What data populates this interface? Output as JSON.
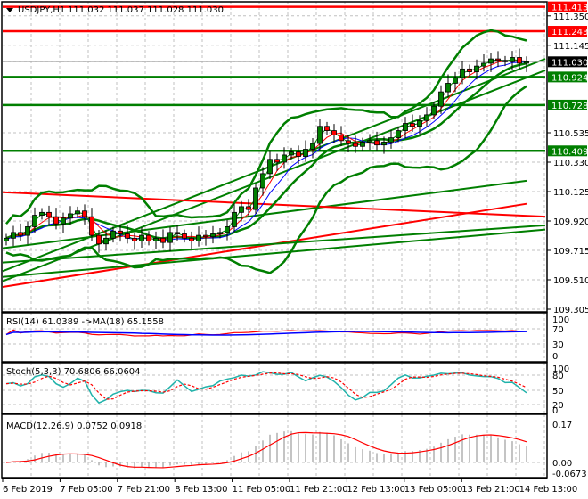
{
  "header": {
    "symbol": "USDJPY,H1",
    "ohlc": "111.032 111.037 111.028 111.030"
  },
  "chart_data": {
    "type": "candlestick",
    "symbol": "USDJPY",
    "timeframe": "H1",
    "price_axis": {
      "range": [
        109.305,
        111.413
      ],
      "ticks": [
        "111.350",
        "111.145",
        "110.535",
        "110.330",
        "110.125",
        "109.920",
        "109.715",
        "109.510",
        "109.305"
      ]
    },
    "time_labels": [
      "6 Feb 2019",
      "7 Feb 05:00",
      "7 Feb 21:00",
      "8 Feb 13:00",
      "11 Feb 05:00",
      "11 Feb 21:00",
      "12 Feb 13:00",
      "13 Feb 05:00",
      "13 Feb 21:00",
      "14 Feb 13:00"
    ],
    "closes": [
      109.8,
      109.84,
      109.82,
      109.88,
      109.96,
      109.98,
      109.95,
      109.9,
      109.94,
      109.97,
      109.99,
      109.95,
      109.82,
      109.76,
      109.8,
      109.85,
      109.83,
      109.8,
      109.78,
      109.82,
      109.78,
      109.8,
      109.77,
      109.84,
      109.83,
      109.8,
      109.78,
      109.82,
      109.81,
      109.83,
      109.84,
      109.88,
      109.98,
      110.02,
      110.0,
      110.15,
      110.25,
      110.35,
      110.33,
      110.38,
      110.4,
      110.37,
      110.42,
      110.46,
      110.58,
      110.55,
      110.52,
      110.48,
      110.46,
      110.44,
      110.47,
      110.48,
      110.45,
      110.47,
      110.5,
      110.55,
      110.6,
      110.58,
      110.62,
      110.66,
      110.72,
      110.82,
      110.88,
      110.92,
      110.98,
      110.96,
      111.0,
      111.02,
      111.05,
      111.04,
      111.03,
      111.06,
      111.02,
      111.03
    ],
    "current_price": {
      "label": "111.030",
      "value": 111.03
    },
    "levels": [
      {
        "label": "111.413",
        "value": 111.413,
        "color": "#ff0000"
      },
      {
        "label": "111.243",
        "value": 111.243,
        "color": "#ff0000"
      },
      {
        "label": "110.924",
        "value": 110.924,
        "color": "#007f00"
      },
      {
        "label": "110.728",
        "value": 110.728,
        "color": "#007f00"
      },
      {
        "label": "110.409",
        "value": 110.409,
        "color": "#007f00"
      }
    ],
    "trend_lines": [
      {
        "start": 109.57,
        "end": 111.05,
        "color": "#007f00"
      },
      {
        "start": 109.5,
        "end": 110.97,
        "color": "#007f00"
      },
      {
        "start": 109.63,
        "end": 109.89,
        "color": "#007f00"
      },
      {
        "start": 109.53,
        "end": 109.86,
        "color": "#007f00"
      },
      {
        "start": 110.12,
        "end": 109.95,
        "color": "#ff0000"
      }
    ],
    "long_mas": [
      {
        "start": 109.73,
        "end": 110.2,
        "color": "#007f00"
      },
      {
        "start": 109.46,
        "end": 110.04,
        "color": "#ff0000"
      }
    ],
    "rsi": {
      "label": "RSI(14) 61.0389  ->MA(18) 65.1558",
      "ticks": [
        "100",
        "70",
        "30",
        "0"
      ]
    },
    "stoch": {
      "label": "Stoch(5,3,3) 70.6806 66.0604",
      "ticks": [
        "100",
        "80",
        "50",
        "20",
        "0"
      ]
    },
    "macd": {
      "label": "MACD(12,26,9) 0.0752 0.0918",
      "ticks": [
        "0.17",
        "0.00",
        "-0.0673"
      ]
    }
  }
}
